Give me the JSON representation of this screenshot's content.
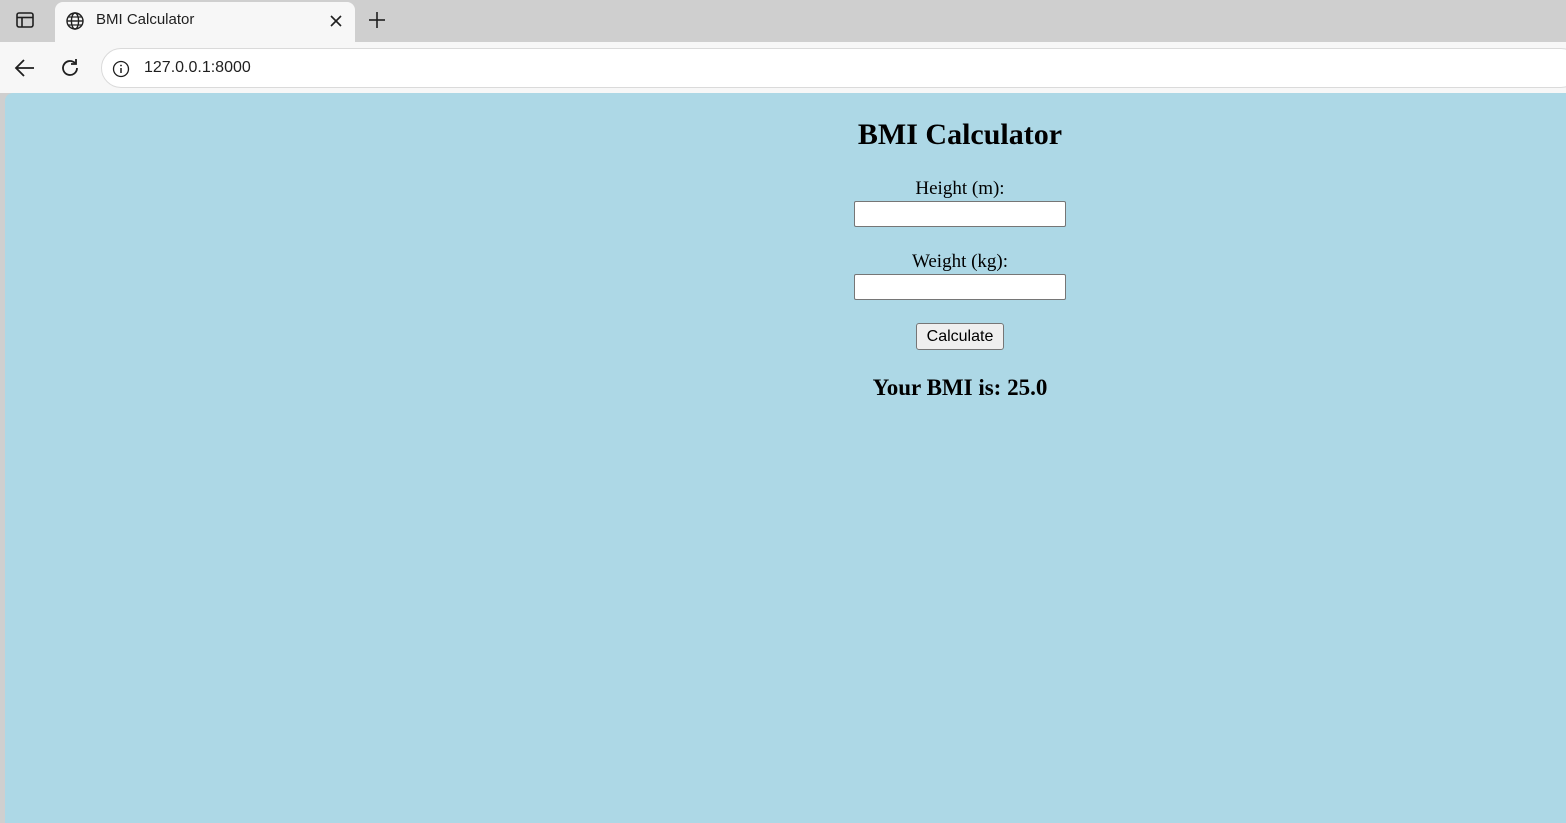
{
  "browser": {
    "tab": {
      "title": "BMI Calculator",
      "favicon": "globe-icon"
    },
    "address_bar": {
      "url": "127.0.0.1:8000"
    },
    "icons": {
      "tab_actions": "tab-actions-icon",
      "close_tab": "close-icon",
      "new_tab": "plus-icon",
      "back": "back-arrow-icon",
      "reload": "reload-icon",
      "site_info": "info-icon"
    }
  },
  "page": {
    "background_color": "#add8e6",
    "title": "BMI Calculator",
    "form": {
      "height_label": "Height (m):",
      "height_value": "",
      "weight_label": "Weight (kg):",
      "weight_value": "",
      "submit_label": "Calculate"
    },
    "result_text": "Your BMI is: 25.0"
  }
}
